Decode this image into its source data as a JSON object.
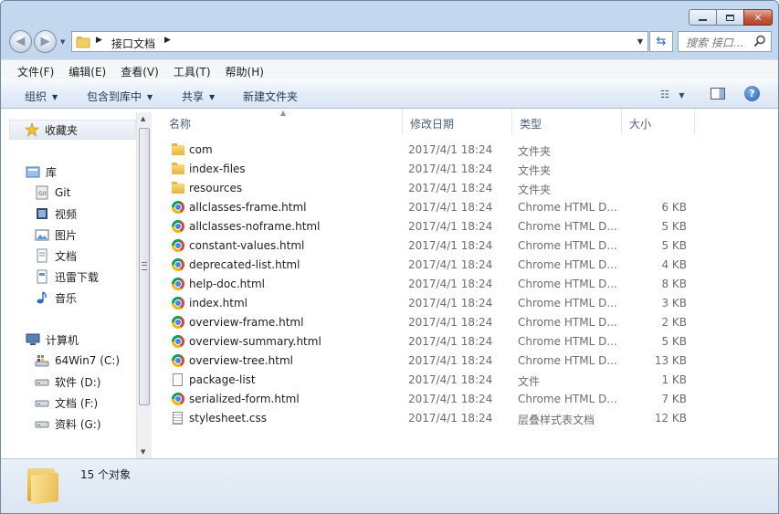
{
  "window": {
    "title": "接口文档",
    "caption_buttons": [
      "minimize",
      "maximize",
      "close"
    ]
  },
  "address": {
    "crumbs": [
      "接口文档"
    ],
    "search_placeholder": "搜索 接口..."
  },
  "menu": [
    "文件(F)",
    "编辑(E)",
    "查看(V)",
    "工具(T)",
    "帮助(H)"
  ],
  "commands": {
    "organize": "组织",
    "include_library": "包含到库中",
    "share": "共享",
    "new_folder": "新建文件夹"
  },
  "sidebar": {
    "favorites": "收藏夹",
    "libraries": "库",
    "library_items": [
      "Git",
      "视频",
      "图片",
      "文档",
      "迅雷下载",
      "音乐"
    ],
    "computer": "计算机",
    "drives": [
      "64Win7  (C:)",
      "软件 (D:)",
      "文档 (F:)",
      "资料 (G:)"
    ]
  },
  "columns": [
    "名称",
    "修改日期",
    "类型",
    "大小"
  ],
  "files": [
    {
      "name": "com",
      "date": "2017/4/1 18:24",
      "type": "文件夹",
      "size": "",
      "icon": "folder-icon"
    },
    {
      "name": "index-files",
      "date": "2017/4/1 18:24",
      "type": "文件夹",
      "size": "",
      "icon": "folder-icon"
    },
    {
      "name": "resources",
      "date": "2017/4/1 18:24",
      "type": "文件夹",
      "size": "",
      "icon": "folder-icon"
    },
    {
      "name": "allclasses-frame.html",
      "date": "2017/4/1 18:24",
      "type": "Chrome HTML D...",
      "size": "6 KB",
      "icon": "chrome-icon"
    },
    {
      "name": "allclasses-noframe.html",
      "date": "2017/4/1 18:24",
      "type": "Chrome HTML D...",
      "size": "5 KB",
      "icon": "chrome-icon"
    },
    {
      "name": "constant-values.html",
      "date": "2017/4/1 18:24",
      "type": "Chrome HTML D...",
      "size": "5 KB",
      "icon": "chrome-icon"
    },
    {
      "name": "deprecated-list.html",
      "date": "2017/4/1 18:24",
      "type": "Chrome HTML D...",
      "size": "4 KB",
      "icon": "chrome-icon"
    },
    {
      "name": "help-doc.html",
      "date": "2017/4/1 18:24",
      "type": "Chrome HTML D...",
      "size": "8 KB",
      "icon": "chrome-icon"
    },
    {
      "name": "index.html",
      "date": "2017/4/1 18:24",
      "type": "Chrome HTML D...",
      "size": "3 KB",
      "icon": "chrome-icon"
    },
    {
      "name": "overview-frame.html",
      "date": "2017/4/1 18:24",
      "type": "Chrome HTML D...",
      "size": "2 KB",
      "icon": "chrome-icon"
    },
    {
      "name": "overview-summary.html",
      "date": "2017/4/1 18:24",
      "type": "Chrome HTML D...",
      "size": "5 KB",
      "icon": "chrome-icon"
    },
    {
      "name": "overview-tree.html",
      "date": "2017/4/1 18:24",
      "type": "Chrome HTML D...",
      "size": "13 KB",
      "icon": "chrome-icon"
    },
    {
      "name": "package-list",
      "date": "2017/4/1 18:24",
      "type": "文件",
      "size": "1 KB",
      "icon": "file-icon"
    },
    {
      "name": "serialized-form.html",
      "date": "2017/4/1 18:24",
      "type": "Chrome HTML D...",
      "size": "7 KB",
      "icon": "chrome-icon"
    },
    {
      "name": "stylesheet.css",
      "date": "2017/4/1 18:24",
      "type": "层叠样式表文档",
      "size": "12 KB",
      "icon": "css-file-icon"
    }
  ],
  "status": {
    "count": "15 个对象"
  },
  "colors": {
    "frame": "#b9cfe7",
    "command_bar": "#dbe6f3",
    "header_text": "#4c607a",
    "secondary_text": "#6d6d6d"
  }
}
